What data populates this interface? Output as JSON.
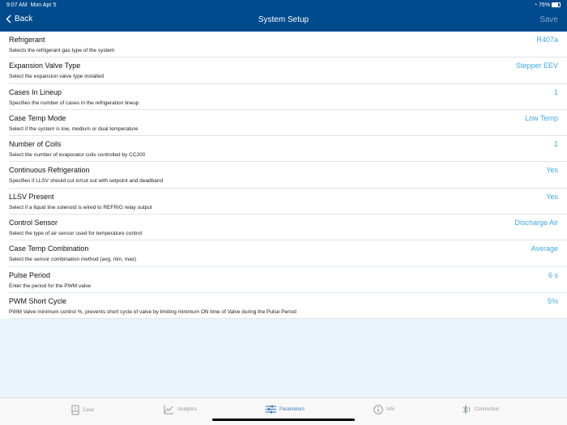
{
  "status": {
    "time": "9:07 AM",
    "date": "Mon Apr 5",
    "battery": "76%"
  },
  "header": {
    "back": "Back",
    "title": "System Setup",
    "save": "Save"
  },
  "rows": [
    {
      "label": "Refrigerant",
      "desc": "Selects the refrigerant gas type of the system",
      "value": "R407a"
    },
    {
      "label": "Expansion Valve Type",
      "desc": "Select the expansion valve type installed",
      "value": "Stepper EEV"
    },
    {
      "label": "Cases In Lineup",
      "desc": "Specifies the number of cases in the refrigeration lineup",
      "value": "1"
    },
    {
      "label": "Case Temp Mode",
      "desc": "Select if the system is low, medium or dual temperature",
      "value": "Low Temp"
    },
    {
      "label": "Number of Coils",
      "desc": "Select the number of evaporator coils controlled by CC200",
      "value": "1"
    },
    {
      "label": "Continuous Refrigeration",
      "desc": "Specifies if LLSV should cut in/cut out with setpoint and deadband",
      "value": "Yes"
    },
    {
      "label": "LLSV Present",
      "desc": "Select if a liquid line solenoid is wired to REFRIG relay output",
      "value": "Yes"
    },
    {
      "label": "Control Sensor",
      "desc": "Select the type of air sensor used for temperature control",
      "value": "Discharge Air"
    },
    {
      "label": "Case Temp Combination",
      "desc": "Select the sensor combination method (avg, min, max)",
      "value": "Average"
    },
    {
      "label": "Pulse Period",
      "desc": "Enter the period for the PWM valve",
      "value": "6 s"
    },
    {
      "label": "PWM Short Cycle",
      "desc": "PWM Valve minimum control %, prevents short cycle of valve by limiting minimum ON time of Valve during the Pulse Period",
      "value": "5%"
    }
  ],
  "tabs": [
    {
      "label": "Case"
    },
    {
      "label": "Analytics"
    },
    {
      "label": "Parameters"
    },
    {
      "label": "Info"
    },
    {
      "label": "Connection"
    }
  ]
}
